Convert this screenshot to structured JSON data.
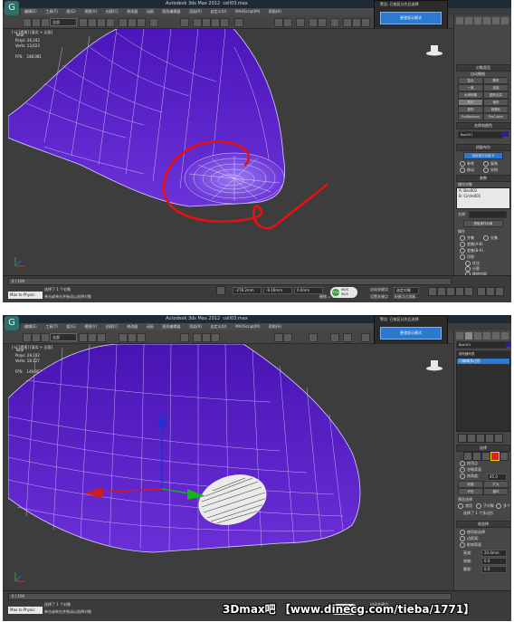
{
  "app": {
    "title": "Autodesk 3ds Max 2012",
    "file": "cell03.max",
    "icon": "3ds-max-icon"
  },
  "menu": {
    "items": [
      "编辑(E)",
      "工具(T)",
      "组(G)",
      "视图(V)",
      "创建(C)",
      "修改器",
      "动画",
      "图形编辑器",
      "渲染(R)",
      "自定义(U)",
      "MAXScript(M)",
      "帮助(H)"
    ]
  },
  "toolbar": {
    "selection_filter": "全部"
  },
  "popup": {
    "title": "警告: 已按区分先后选择",
    "button": "更改显示模式"
  },
  "screenshot1": {
    "viewport_label": "[+] [透视] [真实 + 边面]",
    "stats": "Total\nPolys: 26,242\nVerts: 13,623\n\nFPS:   248.081",
    "right_panel": {
      "object_type_header": "对象类型",
      "auto_grid": "自动栅格",
      "buttons": [
        "复合",
        "散布",
        "一致",
        "连接",
        "水滴网格",
        "图形合并",
        "布尔",
        "地形",
        "放样",
        "网格化",
        "ProBoolean",
        "ProCutter"
      ],
      "name_color_header": "名称和颜色",
      "object_name": "Box001",
      "pick_boolean_header": "拾取布尔",
      "pick_operand_button": "拾取操作对象 B",
      "pick_options": [
        "参考",
        "复制",
        "移动",
        "实例"
      ],
      "params_header": "参数",
      "operands_label": "操作对象",
      "operands": [
        "A: Box001",
        "B: Circle001"
      ],
      "name_label": "名称:",
      "extract_button": "提取操作对象",
      "operation_label": "操作",
      "operations": [
        "并集",
        "交集",
        "差集(A-B)",
        "差集(B-A)",
        "切割"
      ],
      "cut_options": [
        "优化",
        "分割",
        "移除内部",
        "移除外部"
      ],
      "display_update_header": "显示/更新"
    },
    "time_slider": "0 / 100",
    "status": {
      "selection": "选择了 1 个对象",
      "prompt": "单击或单击并拖动以选择对象",
      "x": "-278.2mm",
      "y": "-9.16mm",
      "z": "0.0mm",
      "grid": "栅格 = 10.0mm",
      "auto_key": "自动关键点",
      "selected_mode": "选定对象",
      "set_key": "设置关键点",
      "key_filters": "关键点过滤器...",
      "maxscript": "Max to Physic"
    },
    "badge": {
      "percent": "75%",
      "up": "0K/S",
      "down": "0K/S"
    }
  },
  "screenshot2": {
    "viewport_label": "[+] [透视] [真实 + 边面]",
    "stats": "Total\nPolys: 28,192\nVerts: 18,127\n\nFPS:   149.923",
    "right_panel": {
      "object_name": "Box001",
      "modifier_list": "修改器列表",
      "stack_item": "可编辑多边形",
      "selection_header": "选择",
      "by_vertex": "按顶点",
      "ignore_backfacing": "忽略背面",
      "by_angle": "按角度:",
      "angle_value": "45.0",
      "shrink": "收缩",
      "grow": "扩大",
      "ring": "环形",
      "loop": "循环",
      "preview_label": "预览选择",
      "preview_options": [
        "禁用",
        "子对象",
        "多个"
      ],
      "selection_count": "选择了 1 个多边形",
      "soft_header": "软选择",
      "use_soft": "使用软选择",
      "edge_distance": "边距离:",
      "affect_backfacing": "影响背面",
      "falloff": "衰减:",
      "falloff_value": "20.0mm",
      "pinch": "收缩:",
      "pinch_value": "0.0",
      "bubble": "膨胀:",
      "bubble_value": "0.0"
    },
    "time_slider": "0 / 100",
    "status": {
      "selection": "选择了 1 个对象",
      "prompt": "单击或单击并拖动以选择对象",
      "auto_key": "自动关键点",
      "maxscript": "Max to Physic"
    },
    "badge": {
      "percent": "75%",
      "up": "0K/S",
      "down": "0K/S"
    }
  },
  "watermark": "3Dmax吧 【www.dinecg.com/tieba/1771】",
  "colors": {
    "mesh": "#5b1fc8",
    "wire": "#e6e0ff",
    "annotation": "#e81010",
    "accent": "#2c79d1"
  }
}
